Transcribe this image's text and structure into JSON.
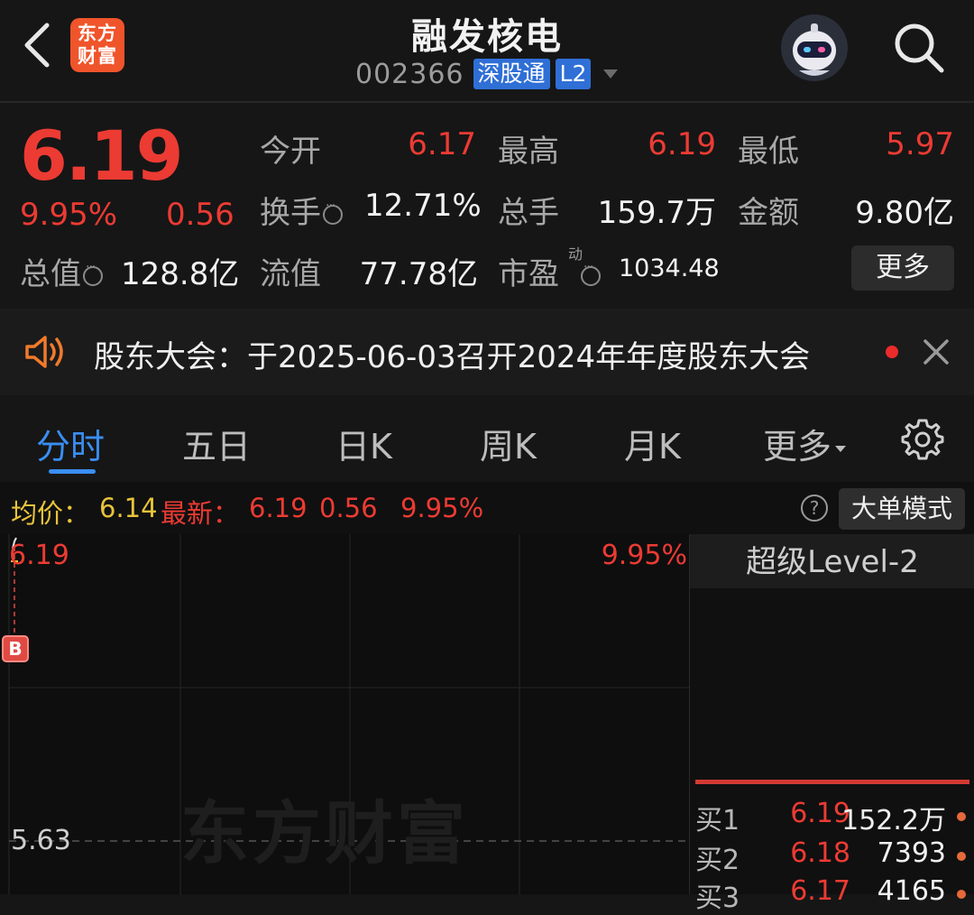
{
  "header": {
    "logo_text_line1": "东方",
    "logo_text_line2": "财富",
    "stock_name": "融发核电",
    "stock_code": "002366",
    "tag_connect": "深股通",
    "tag_level": "L2"
  },
  "quote": {
    "price": "6.19",
    "change_pct": "9.95%",
    "change_amt": "0.56",
    "open_label": "今开",
    "open_value": "6.17",
    "high_label": "最高",
    "high_value": "6.19",
    "low_label": "最低",
    "low_value": "5.97",
    "turnover_label": "换手",
    "turnover_value": "12.71%",
    "volume_label": "总手",
    "volume_value": "159.7万",
    "amount_label": "金额",
    "amount_value": "9.80亿",
    "total_mv_label": "总值",
    "total_mv_value": "128.8亿",
    "float_mv_label": "流值",
    "float_mv_value": "77.78亿",
    "pe_label": "市盈",
    "pe_sup": "动",
    "pe_value": "1034.48",
    "more_label": "更多"
  },
  "notice": {
    "text": "股东大会：于2025-06-03召开2024年年度股东大会"
  },
  "tabs": [
    {
      "label": "分时"
    },
    {
      "label": "五日"
    },
    {
      "label": "日K"
    },
    {
      "label": "周K"
    },
    {
      "label": "月K"
    },
    {
      "label": "更多"
    }
  ],
  "summary": {
    "avg_label": "均价：",
    "avg_value": "6.14",
    "latest_label": "最新：",
    "latest_price": "6.19",
    "latest_change": "0.56",
    "latest_pct": "9.95%",
    "help_glyph": "?",
    "mode_button": "大单模式"
  },
  "chart": {
    "top_price": "6.19",
    "top_pct": "9.95%",
    "prev_close": "5.63",
    "b_marker": "B",
    "watermark": "东方财富"
  },
  "level2": {
    "title": "超级Level-2",
    "rows": [
      {
        "label": "买1",
        "price": "6.19",
        "volume": "152.2万"
      },
      {
        "label": "买2",
        "price": "6.18",
        "volume": "7393"
      },
      {
        "label": "买3",
        "price": "6.17",
        "volume": "4165"
      }
    ]
  },
  "colors": {
    "up": "#ec3b33",
    "accent": "#3a8ef2",
    "background": "#161616",
    "logo": "#f0542b",
    "notice_icon": "#f07a2b"
  }
}
